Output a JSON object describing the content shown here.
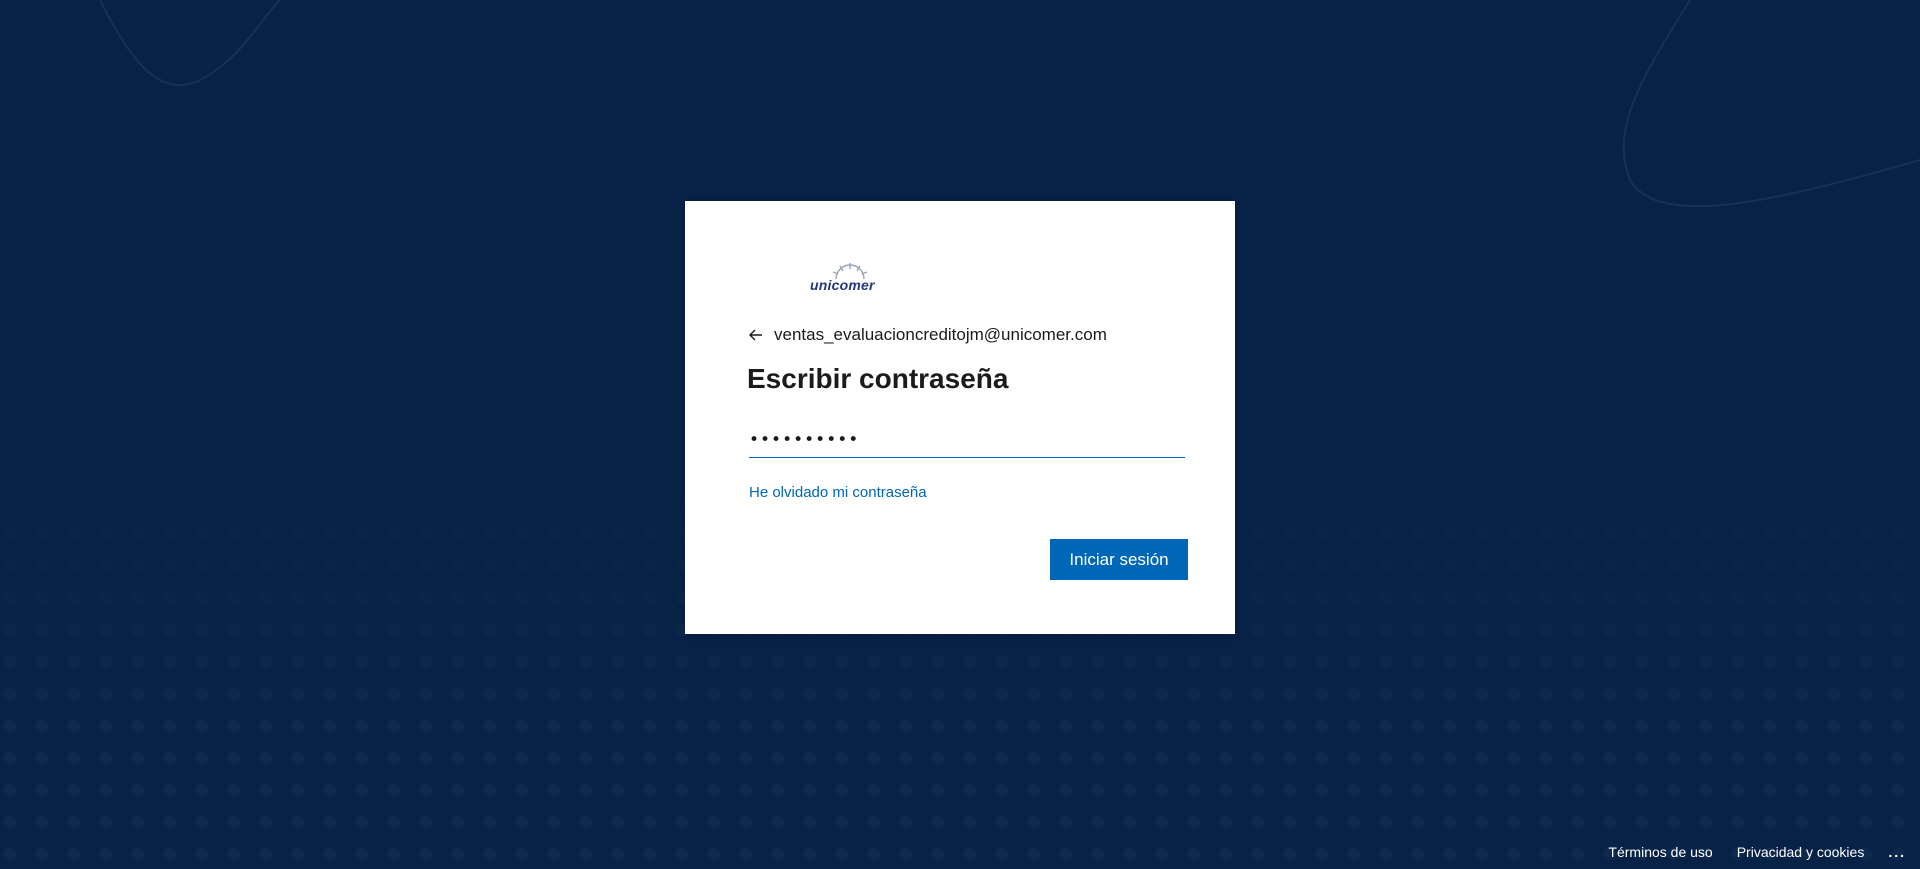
{
  "login": {
    "logo_text": "unicomer",
    "identity_email": "ventas_evaluacioncreditojm@unicomer.com",
    "title": "Escribir contraseña",
    "password_value": "••••••••••",
    "forgot_link": "He olvidado mi contraseña",
    "signin_button": "Iniciar sesión"
  },
  "footer": {
    "terms": "Términos de uso",
    "privacy": "Privacidad y cookies",
    "more": "..."
  },
  "colors": {
    "background": "#072147",
    "accent": "#0067b8",
    "card": "#ffffff"
  }
}
